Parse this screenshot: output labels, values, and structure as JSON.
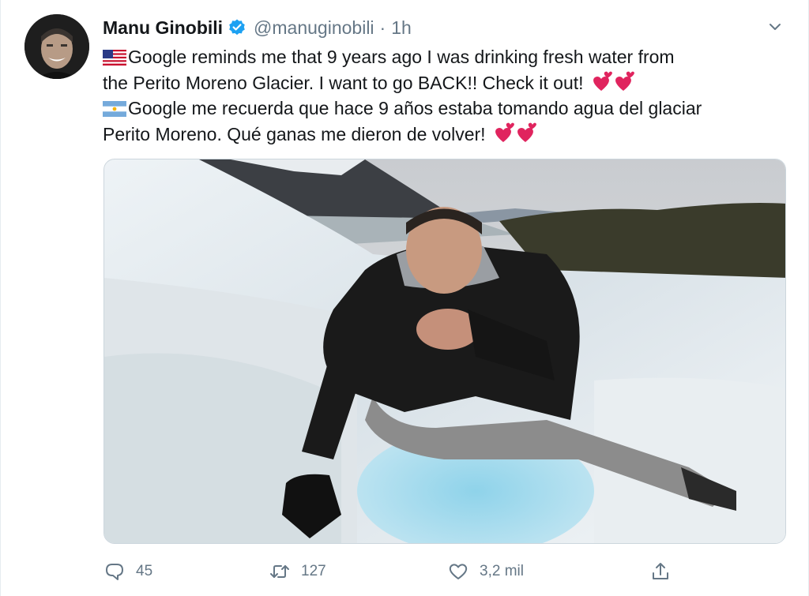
{
  "tweet": {
    "author_name": "Manu Ginobili",
    "handle": "@manuginobili",
    "separator": "·",
    "time": "1h",
    "lines": [
      "Google reminds me that 9 years ago I was drinking fresh water from",
      "the Perito Moreno Glacier. I want to go BACK!! Check it out!",
      "Google me recuerda que hace 9 años estaba tomando agua del glaciar",
      "Perito Moreno. Qué ganas me dieron de volver!"
    ],
    "flag_icons": [
      "us-flag-icon",
      "argentina-flag-icon"
    ],
    "emoji": "two-hearts-emoji"
  },
  "actions": {
    "reply_count": "45",
    "retweet_count": "127",
    "like_count": "3,2 mil"
  },
  "colors": {
    "text": "#14171a",
    "secondary": "#657786",
    "verified_blue": "#1da1f2",
    "heart_red": "#e0245e",
    "border": "#e6ecf0"
  },
  "icons": {
    "verified": "verified-badge-icon",
    "menu": "chevron-down-icon",
    "reply": "reply-icon",
    "retweet": "retweet-icon",
    "like": "heart-icon",
    "share": "share-icon"
  }
}
